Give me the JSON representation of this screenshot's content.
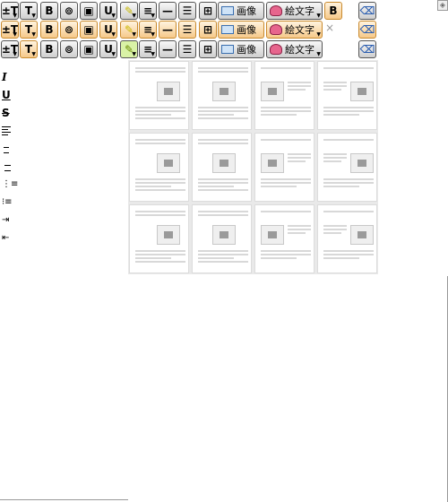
{
  "toolbar": {
    "rows": [
      {
        "highlight_first": false
      },
      {
        "highlight_first": true
      },
      {
        "highlight_first": false
      }
    ],
    "buttons": {
      "font_size": "±T",
      "text_style": "T",
      "bold": "B",
      "link": "link-icon",
      "image_insert": "frame-icon",
      "underline_fmt": "U",
      "highlighter": "highlighter-icon",
      "align": "align-icon",
      "hr": "—",
      "list": "list-icon",
      "table": "table-icon",
      "image_label": "画像",
      "emoji_label": "絵文字",
      "bold_extra": "B",
      "clear_format": "clear-format-icon"
    },
    "close": "×"
  },
  "side_menu": {
    "italic": "I",
    "underline": "U",
    "strikethrough": "S"
  },
  "templates": {
    "rows": 3,
    "cols": 4
  },
  "colors": {
    "accent": "#f6c98a",
    "button_bg": "#dcdcdc",
    "grid_bg": "#e9e9e9"
  }
}
